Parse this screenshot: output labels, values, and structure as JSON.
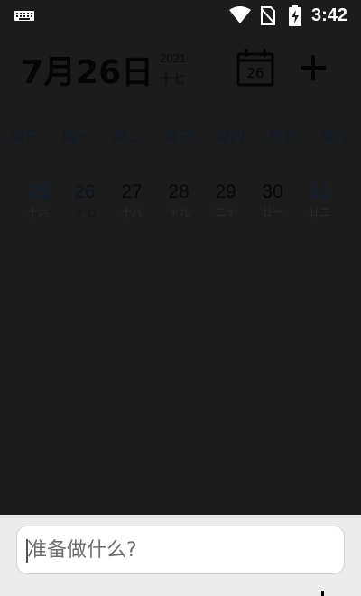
{
  "status_bar": {
    "time": "3:42",
    "icons": [
      "keyboard-icon",
      "wifi-icon",
      "no-sim-icon",
      "battery-charging-icon"
    ]
  },
  "header": {
    "date_title": "7月26日",
    "year": "2021",
    "lunar_day": "十七",
    "calendar_button_day": "26",
    "add_button_icon": "plus-icon"
  },
  "week": {
    "weekday_labels": [
      "周日",
      "周一",
      "周二",
      "周三",
      "周四",
      "周五",
      "周六"
    ],
    "days": [
      {
        "num": "25",
        "lunar": "十六"
      },
      {
        "num": "26",
        "lunar": "十七"
      },
      {
        "num": "27",
        "lunar": "十八"
      },
      {
        "num": "28",
        "lunar": "十九"
      },
      {
        "num": "29",
        "lunar": "二十"
      },
      {
        "num": "30",
        "lunar": "廿一"
      },
      {
        "num": "31",
        "lunar": "廿二"
      }
    ]
  },
  "todo_input": {
    "placeholder": "准备做什么?",
    "value": ""
  },
  "colors": {
    "background": "#1c1c1c",
    "input_panel": "#ececec",
    "weekend_accent": "#0f2032"
  }
}
